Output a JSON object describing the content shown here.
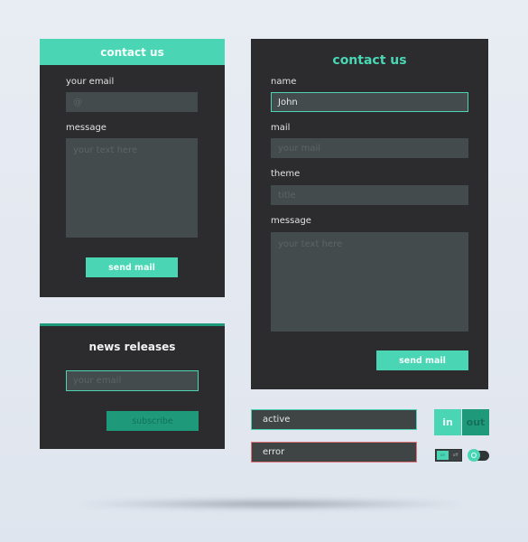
{
  "colors": {
    "accent": "#4ad6b5",
    "accent_dark": "#1e9a7b",
    "panel": "#2c2c2e",
    "field": "#444b4c",
    "error": "#e0727a",
    "background": "#e5e9f1"
  },
  "contact_small": {
    "header": "contact us",
    "email_label": "your email",
    "email_placeholder": "@",
    "message_label": "message",
    "message_placeholder": "your text here",
    "send_button": "send mail"
  },
  "news": {
    "title": "news releases",
    "email_placeholder": "your email",
    "subscribe_button": "subscribe"
  },
  "contact_large": {
    "title": "contact us",
    "name_label": "name",
    "name_value": "John",
    "mail_label": "mail",
    "mail_placeholder": "your mail",
    "theme_label": "theme",
    "theme_placeholder": "title",
    "message_label": "message",
    "message_placeholder": "your text here",
    "send_button": "send mail"
  },
  "states": {
    "active_value": "active",
    "error_value": "error"
  },
  "segmented": {
    "in_label": "in",
    "out_label": "out",
    "selected": "in"
  },
  "mini_toggle": {
    "on_label": "on",
    "off_label": "off",
    "value": "on"
  },
  "switch": {
    "on": true,
    "icon": "circle-icon"
  }
}
